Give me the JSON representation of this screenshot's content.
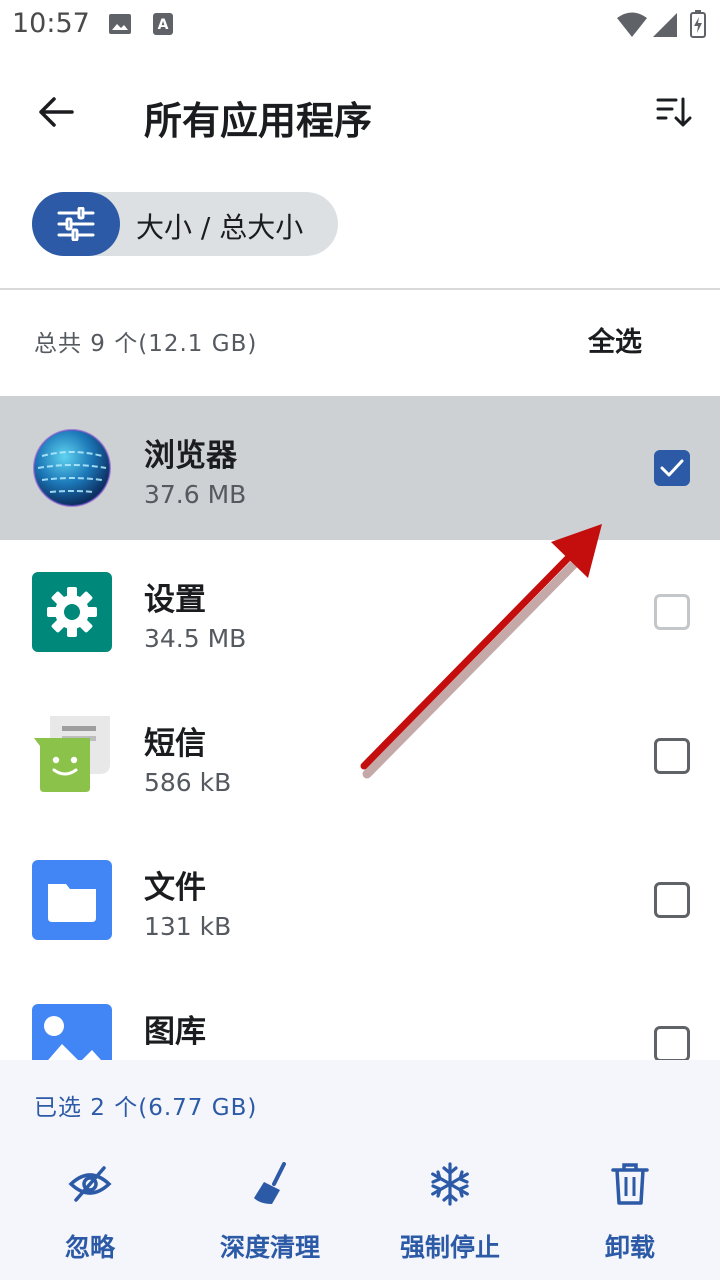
{
  "status_bar": {
    "time": "10:57",
    "icons": [
      "image-icon",
      "a-notification-icon",
      "wifi-icon",
      "signal-icon",
      "battery-charging-icon"
    ]
  },
  "app_bar": {
    "title": "所有应用程序",
    "back_icon": "arrow-left-icon",
    "sort_icon": "sort-icon"
  },
  "filter_chip": {
    "label": "大小 / 总大小",
    "icon": "tune-icon"
  },
  "summary": {
    "total_text": "总共 9 个(12.1 GB)",
    "select_all_label": "全选"
  },
  "apps": [
    {
      "name": "浏览器",
      "size": "37.6 MB",
      "icon": "globe-browser-icon",
      "checked": true
    },
    {
      "name": "设置",
      "size": "34.5 MB",
      "icon": "settings-gear-icon",
      "checked": false
    },
    {
      "name": "短信",
      "size": "586 kB",
      "icon": "messaging-icon",
      "checked": false
    },
    {
      "name": "文件",
      "size": "131 kB",
      "icon": "files-folder-icon",
      "checked": false
    },
    {
      "name": "图库",
      "size": "",
      "icon": "gallery-icon",
      "checked": false
    }
  ],
  "bottom_bar": {
    "selected_text": "已选 2 个(6.77 GB)",
    "actions": [
      {
        "label": "忽略",
        "icon": "eye-off-icon"
      },
      {
        "label": "深度清理",
        "icon": "broom-icon"
      },
      {
        "label": "强制停止",
        "icon": "snowflake-icon"
      },
      {
        "label": "卸载",
        "icon": "trash-icon"
      }
    ]
  },
  "colors": {
    "accent": "#2c5aa6",
    "selected_row": "#ced1d3",
    "annotation_arrow": "#c40d0d"
  }
}
